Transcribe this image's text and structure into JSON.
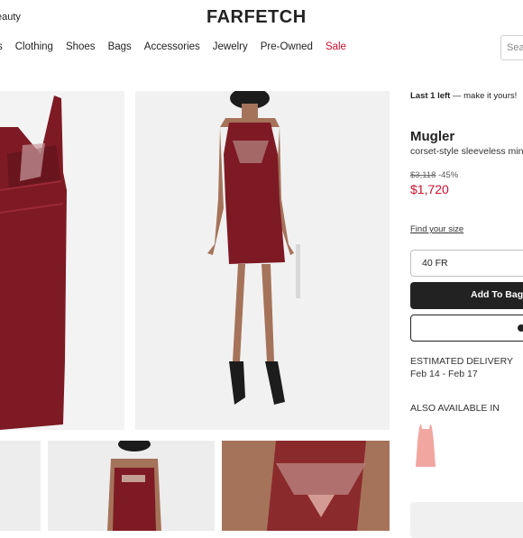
{
  "header": {
    "top_link": "eauty",
    "logo": "FARFETCH",
    "nav": [
      "s",
      "Clothing",
      "Shoes",
      "Bags",
      "Accessories",
      "Jewelry",
      "Pre-Owned",
      "Sale"
    ],
    "search_placeholder": "Sea"
  },
  "product": {
    "stock_bold": "Last 1 left",
    "stock_rest": " — make it yours!",
    "brand": "Mugler",
    "description": "corset-style sleeveless min",
    "old_price": "$3,118",
    "discount": "-45%",
    "price": "$1,720",
    "find_size": "Find your size",
    "size_selected": "40 FR",
    "add_to_bag": "Add To Bag",
    "delivery_label": "ESTIMATED DELIVERY",
    "delivery_dates": "Feb 14 - Feb 17",
    "also_available": "ALSO AVAILABLE IN"
  },
  "colors": {
    "dress": "#7e1a24",
    "sale": "#c8102e",
    "alt_color": "#f1a6a0"
  }
}
